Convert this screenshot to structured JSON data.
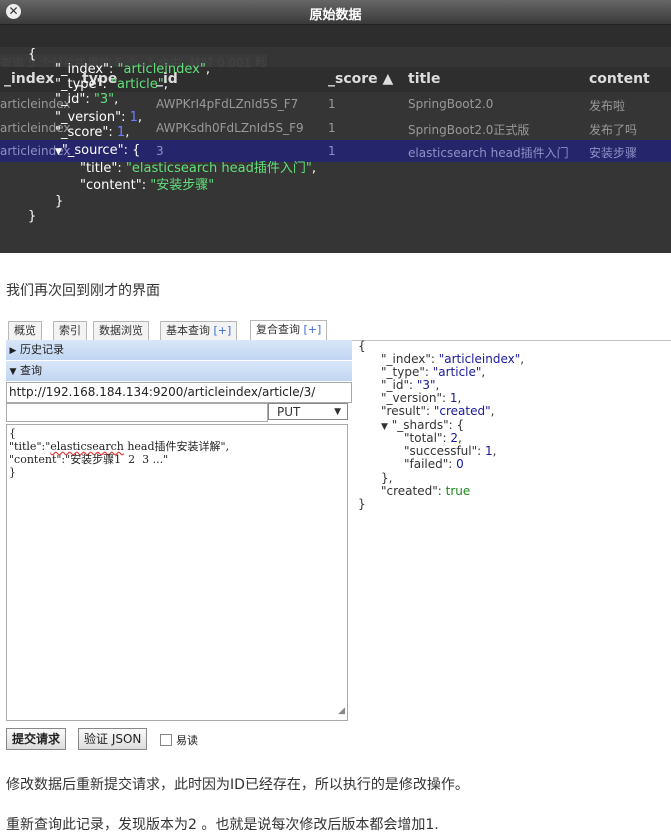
{
  "dialog": {
    "title": "原始数据",
    "close_label": "✕",
    "background": {
      "status_text": "查询 5 个分片中用的 5 个. 3 命中. 耗时 0.001 秒",
      "columns": [
        "_index",
        "_type",
        "_id",
        "_score ▲",
        "title",
        "content"
      ],
      "rows": [
        {
          "index": "articleindex",
          "id": "AWPKrI4pFdLZnId5S_F7",
          "score": "1",
          "title": "SpringBoot2.0",
          "content": "发布啦"
        },
        {
          "index": "articleindex",
          "id": "AWPKsdh0FdLZnId5S_F9",
          "score": "1",
          "title": "SpringBoot2.0正式版",
          "content": "发布了吗"
        },
        {
          "index": "articleindex",
          "id": "3",
          "score": "1",
          "title": "elasticsearch head插件入门",
          "content": "安装步骤"
        }
      ]
    },
    "json": {
      "open": "{",
      "index_key": "\"_index\"",
      "index_val": "\"articleindex\"",
      "type_key": "\"_type\"",
      "type_val": "\"article\"",
      "id_key": "\"_id\"",
      "id_val": "\"3\"",
      "version_key": "\"_version\"",
      "version_val": "1",
      "score_key": "\"_score\"",
      "score_val": "1",
      "source_key": "\"_source\"",
      "title_key": "\"title\"",
      "title_val": "\"elasticsearch head插件入门\"",
      "content_key": "\"content\"",
      "content_val": "\"安装步骤\"",
      "close_inner": "}",
      "close": "}"
    }
  },
  "para1": "我们再次回到刚才的界面",
  "panel": {
    "tabs": [
      {
        "label": "概览"
      },
      {
        "label": "索引"
      },
      {
        "label": "数据浏览"
      },
      {
        "label": "基本查询",
        "plus": "[+]"
      },
      {
        "label": "复合查询",
        "plus": "[+]"
      }
    ],
    "history_label": "历史记录",
    "query_label": "查询",
    "url_value": "http://192.168.184.134:9200/articleindex/article/3/",
    "method": "PUT",
    "body": {
      "line1": "{",
      "title_prefix": "\"title\":\"",
      "title_underlined": "elasticsearch",
      "title_suffix": " head插件安装详解\",",
      "content_line": "\"content\":\"安装步骤1  2  3 ...\"",
      "line_end": "}"
    },
    "submit_label": "提交请求",
    "validate_label": "验证 JSON",
    "readable_label": "易读",
    "result": {
      "open": "{",
      "index_key": "\"_index\"",
      "index_val": "\"articleindex\"",
      "type_key": "\"_type\"",
      "type_val": "\"article\"",
      "id_key": "\"_id\"",
      "id_val": "\"3\"",
      "version_key": "\"_version\"",
      "version_val": "1",
      "result_key": "\"result\"",
      "result_val": "\"created\"",
      "shards_key": "\"_shards\"",
      "total_key": "\"total\"",
      "total_val": "2",
      "successful_key": "\"successful\"",
      "successful_val": "1",
      "failed_key": "\"failed\"",
      "failed_val": "0",
      "close_inner": "},",
      "created_key": "\"created\"",
      "created_val": "true",
      "close": "}"
    }
  },
  "para2": "修改数据后重新提交请求，此时因为ID已经存在，所以执行的是修改操作。",
  "para3": "重新查询此记录，发现版本为2 。也就是说每次修改后版本都会增加1."
}
